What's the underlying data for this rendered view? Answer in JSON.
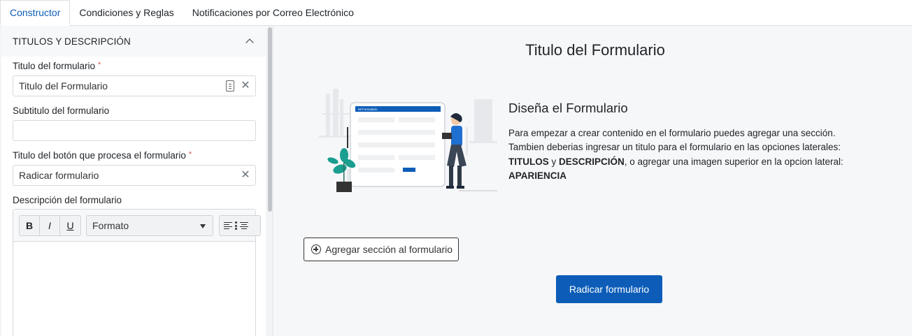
{
  "tabs": [
    {
      "label": "Constructor",
      "active": true
    },
    {
      "label": "Condiciones y Reglas",
      "active": false
    },
    {
      "label": "Notificaciones por Correo Electrónico",
      "active": false
    }
  ],
  "sidebar": {
    "section_title": "TITULOS Y DESCRIPCIÓN",
    "title_field": {
      "label": "Titulo del formulario",
      "required": "*",
      "value": "Titulo del Formulario"
    },
    "subtitle_field": {
      "label": "Subtitulo del formulario",
      "value": ""
    },
    "button_field": {
      "label": "Titulo del botón que procesa el formulario",
      "required": "*",
      "value": "Radicar formulario"
    },
    "description_field": {
      "label": "Descripción del formulario"
    },
    "editor": {
      "bold": "B",
      "italic": "I",
      "underline": "U",
      "format": "Formato"
    }
  },
  "preview": {
    "form_title": "Titulo del Formulario",
    "design_title": "Diseña el Formulario",
    "design_text_1": "Para empezar a crear contenido en el formulario puedes agregar una sección. Tambien deberias ingresar un titulo para el formulario en las opciones laterales: ",
    "bold_1": "TITULOS",
    "text_y": " y ",
    "bold_2": "DESCRIPCIÓN",
    "design_text_2": ", o agregar una imagen superior en la opcion lateral: ",
    "bold_3": "APARIENCIA",
    "add_section_label": "Agregar sección al formulario",
    "submit_label": "Radicar formulario",
    "illustration_header": "Mi Formulario"
  },
  "colors": {
    "primary": "#0d5db8",
    "accent_teal": "#1a9e8f"
  }
}
